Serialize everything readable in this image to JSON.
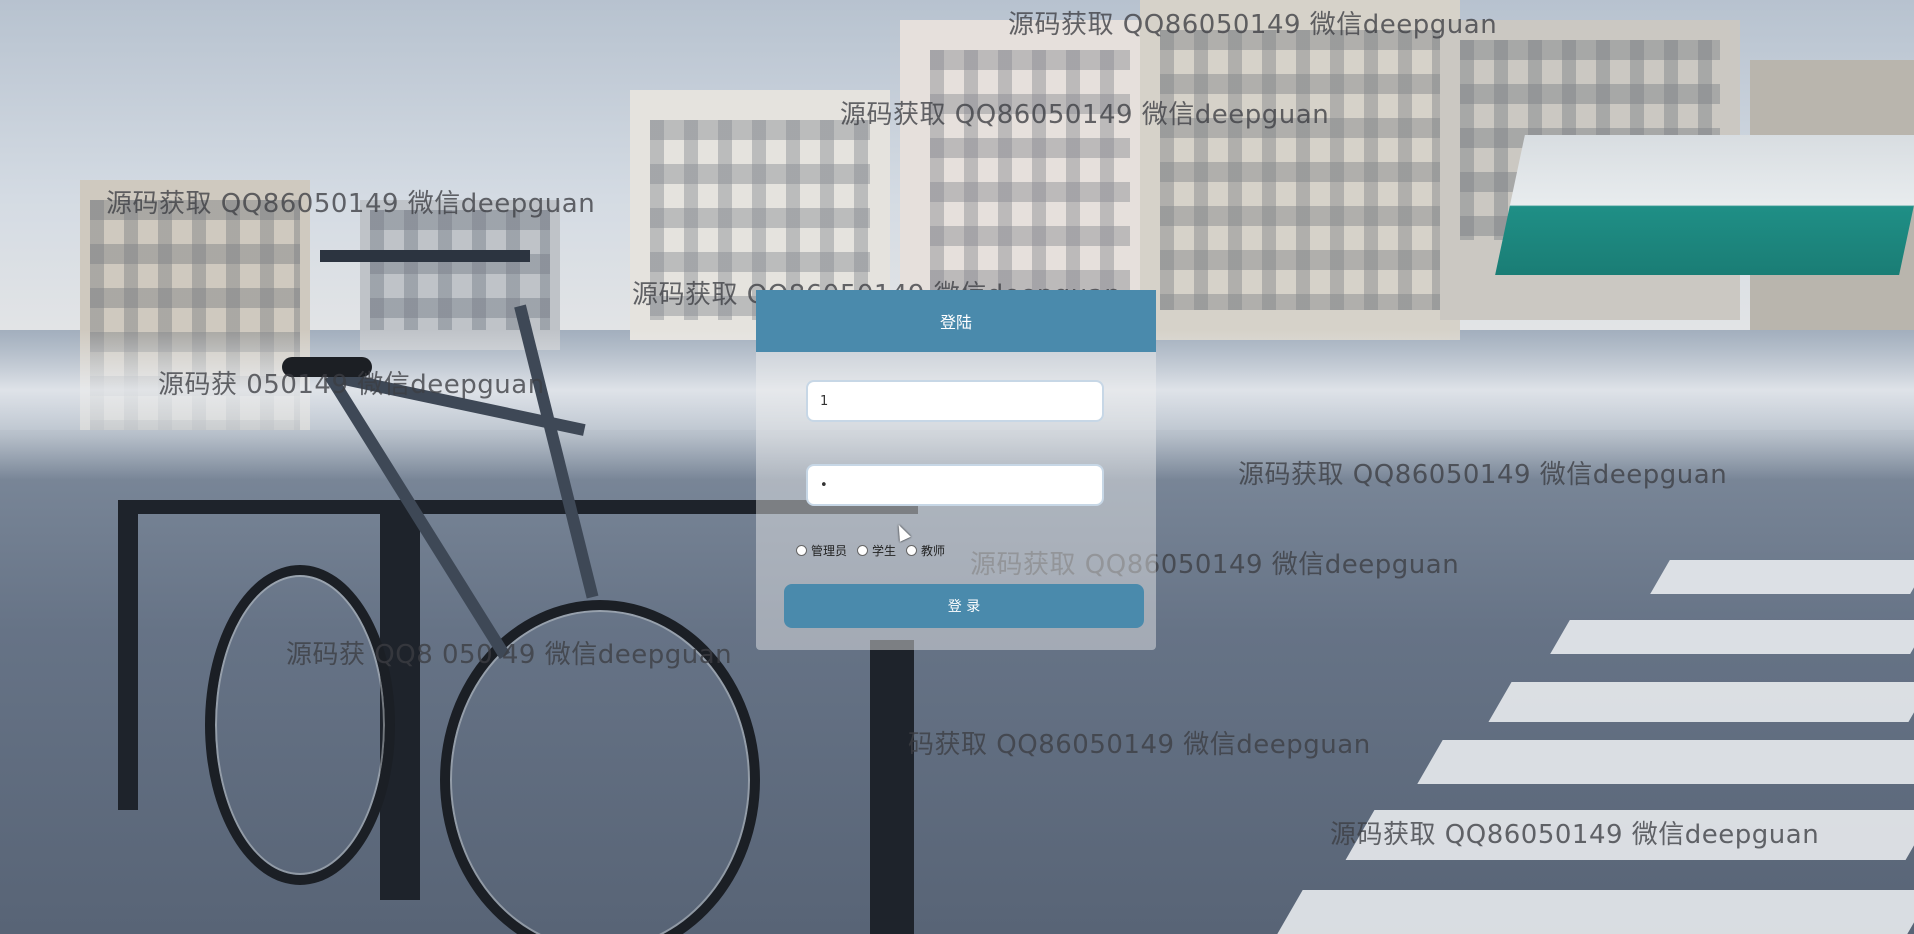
{
  "login": {
    "title": "登陆",
    "username_value": "1",
    "password_value": "•",
    "roles": [
      {
        "label": "管理员",
        "checked": false
      },
      {
        "label": "学生",
        "checked": false
      },
      {
        "label": "教师",
        "checked": false
      }
    ],
    "submit_label": "登 录"
  },
  "watermark": {
    "text_full": "源码获取 QQ86050149 微信deepguan",
    "text_partial_1": "源码获取 QQ86050149 微信deepguan",
    "text_partial_2": "源码获 050149 微信deepguan",
    "text_partial_3": "源码获 QQ8 050 49 微信deepguan",
    "text_partial_4": "码获取 QQ86050149 微信deepguan"
  },
  "colors": {
    "header": "#4a8aac",
    "button": "#4a8aac",
    "panel": "rgba(240,240,240,0.45)"
  }
}
